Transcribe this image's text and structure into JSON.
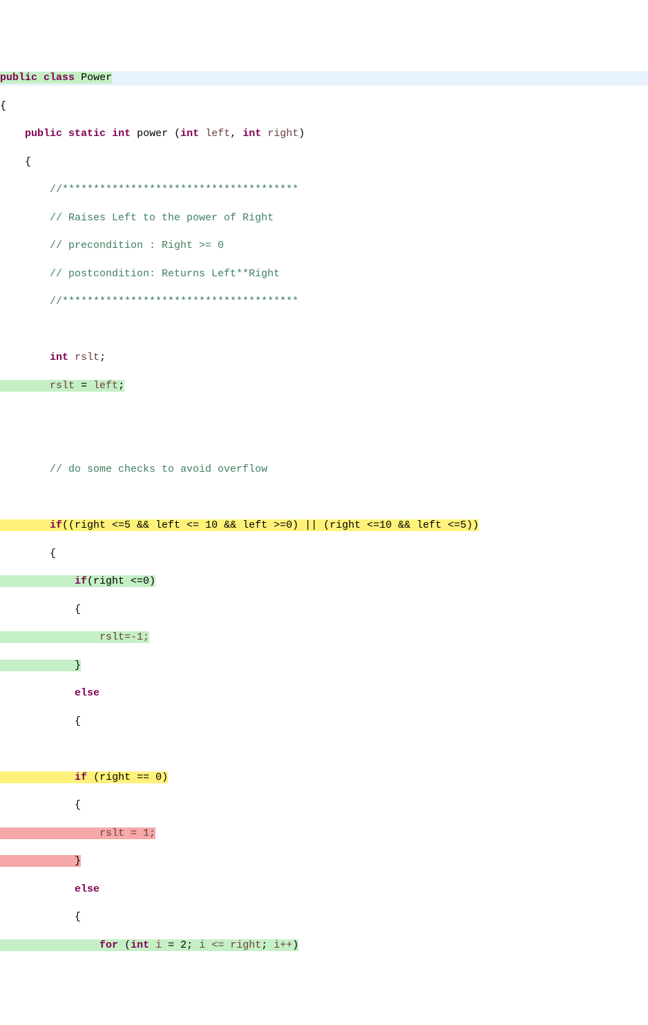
{
  "code": {
    "kw_public": "public",
    "kw_class": "class",
    "classname": "Power",
    "kw_static": "static",
    "kw_int": "int",
    "fn_name": "power",
    "param_left": "left",
    "param_right": "right",
    "comment_bar1": "//**************************************",
    "comment_l1": "// Raises Left to the power of Right",
    "comment_l2": "// precondition : Right >= 0",
    "comment_l3": "// postcondition: Returns Left**Right",
    "comment_bar2": "//**************************************",
    "decl_rslt": "rslt",
    "assign_rslt_left_lhs": "rslt",
    "assign_rslt_left_eq": " = ",
    "assign_rslt_left_rhs": "left",
    "comment_overflow": "// do some checks to avoid overflow",
    "kw_if": "if",
    "kw_else": "else",
    "kw_for": "for",
    "cond_main_p1": "((right <=5 && left <= 10 && left >=0) || (right <=10 && left <=5))",
    "cond_right_le0": "(right <=0)",
    "assign_rslt_neg1": "rslt=-1;",
    "cond_right_eq0": "(right == 0)",
    "assign_rslt_1": "rslt = 1;",
    "for_head": "(",
    "for_var_i": "i",
    "for_init_val": "2",
    "for_cond": "i <= right",
    "for_inc": "i++",
    "semicolon": ";",
    "comma": ",",
    "lparen": "(",
    "rparen": ")",
    "lbrace": "{",
    "rbrace": "}"
  }
}
